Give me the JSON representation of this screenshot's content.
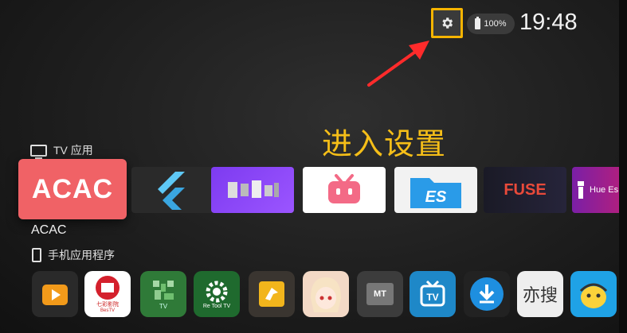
{
  "status": {
    "battery_text": "100%",
    "clock": "19:48"
  },
  "annotation": {
    "text": "进入设置",
    "color": "#f5be18",
    "highlight_color": "#f6b400",
    "arrow_color": "#ff2b2b"
  },
  "sections": {
    "tv_apps_header": "TV 应用",
    "phone_apps_header": "手机应用程序"
  },
  "tv_apps": {
    "focused_label": "ACAC",
    "tiles": [
      {
        "text": "ACAC",
        "icon": "acac-logo-icon"
      },
      {
        "text": "",
        "icon": "flutter-logo-icon"
      },
      {
        "text": "",
        "icon": "pixelated-tile-icon"
      },
      {
        "text": "",
        "icon": "bilibili-tv-icon"
      },
      {
        "text": "ES",
        "icon": "es-file-explorer-icon"
      },
      {
        "text": "FUSE",
        "icon": "fuse-logo-icon"
      },
      {
        "text": "Hue Es",
        "icon": "hue-essentials-icon"
      }
    ]
  },
  "phone_apps": {
    "icons": [
      {
        "icon": "play-tv-icon",
        "text": ""
      },
      {
        "icon": "qicai-tv-icon",
        "text": "七彩影院",
        "sub": "BesTV"
      },
      {
        "icon": "pixelated-qr-icon",
        "text": "TV"
      },
      {
        "icon": "re-tool-tv-icon",
        "text": "Re Tool TV"
      },
      {
        "icon": "bird-app-icon",
        "text": ""
      },
      {
        "icon": "anime-girl-icon",
        "text": ""
      },
      {
        "icon": "mt-manager-icon",
        "text": "MT"
      },
      {
        "icon": "tv-box-icon",
        "text": "TV"
      },
      {
        "icon": "download-icon",
        "text": ""
      },
      {
        "icon": "yisou-icon",
        "text": "亦搜"
      },
      {
        "icon": "mascot-app-icon",
        "text": ""
      }
    ]
  }
}
